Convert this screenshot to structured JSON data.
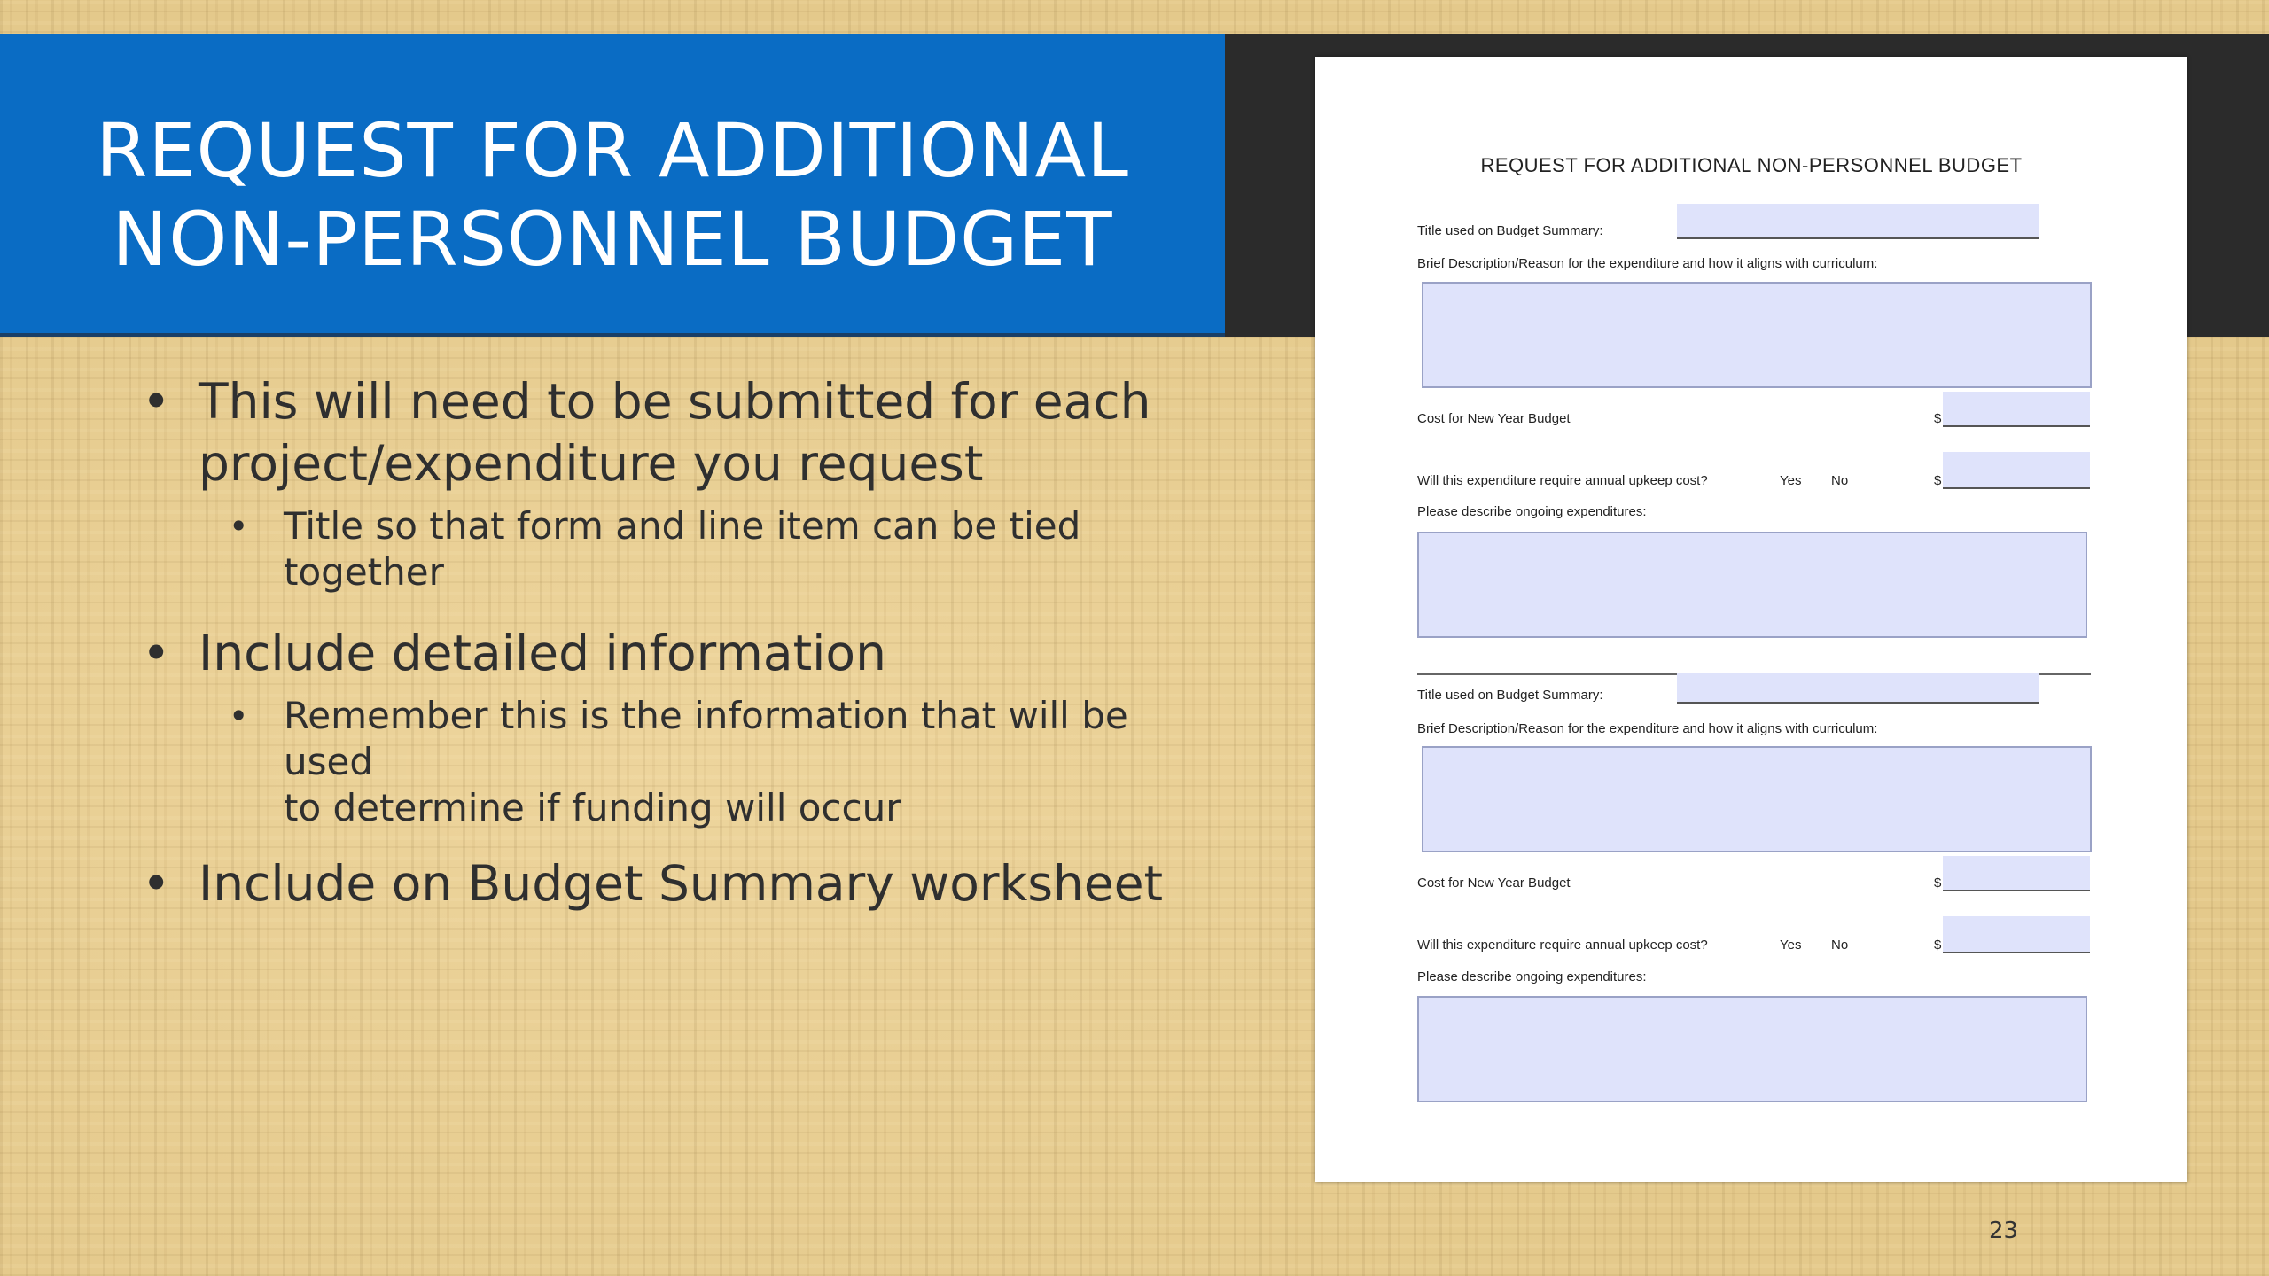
{
  "slide": {
    "title_line1": "REQUEST FOR ADDITIONAL",
    "title_line2": "NON-PERSONNEL BUDGET",
    "page_number": "23"
  },
  "bullets": [
    {
      "text_line1": "This will need to be submitted for each",
      "text_line2": "project/expenditure you request",
      "sub": [
        "Title so that form and line item can be tied together"
      ]
    },
    {
      "text_line1": "Include detailed information",
      "sub_line1": "Remember this is the information that will be used",
      "sub_line2": "to determine if funding will occur"
    },
    {
      "text_line1": "Include on Budget Summary worksheet"
    }
  ],
  "form": {
    "title": "REQUEST FOR ADDITIONAL NON-PERSONNEL BUDGET",
    "title_label": "Title used on Budget Summary:",
    "desc_label": "Brief Description/Reason for the expenditure and how it aligns with curriculum:",
    "cost_label": "Cost for New Year Budget",
    "dollar": "$",
    "upkeep_label": "Will this expenditure require annual upkeep cost?",
    "yes": "Yes",
    "no": "No",
    "ongoing_label": "Please describe ongoing expenditures:",
    "field_color": "#dfe3fb"
  },
  "colors": {
    "title_bar": "#0a6cc4",
    "dark_band": "#2b2b2b"
  }
}
